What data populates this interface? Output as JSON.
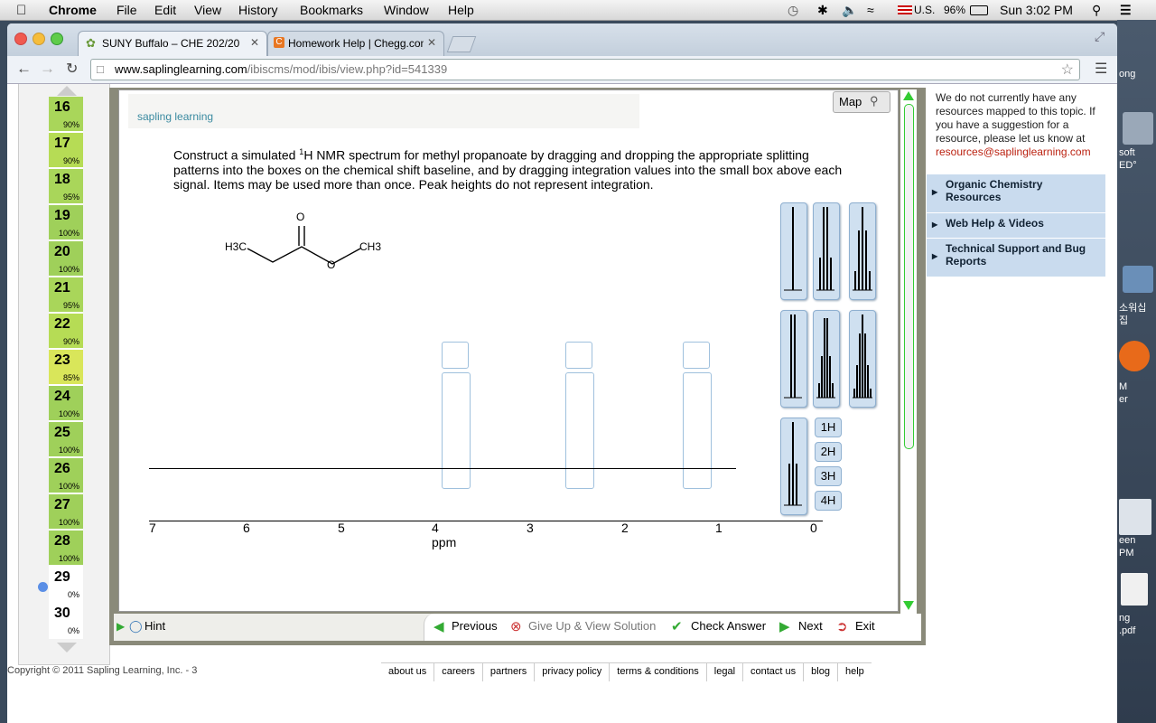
{
  "menubar": {
    "app": "Chrome",
    "items": [
      "File",
      "Edit",
      "View",
      "History",
      "Bookmarks",
      "Window",
      "Help"
    ],
    "input_source": "U.S.",
    "battery": "96%",
    "clock": "Sun 3:02 PM"
  },
  "tabs": [
    {
      "title": "SUNY Buffalo – CHE 202/20"
    },
    {
      "title": "Homework Help | Chegg.com"
    }
  ],
  "address": {
    "domain": "www.saplinglearning.com",
    "path": "/ibiscms/mod/ibis/view.php?id=541339"
  },
  "questions": [
    {
      "n": "16",
      "pct": "90%",
      "color": "#a9d65a"
    },
    {
      "n": "17",
      "pct": "90%",
      "color": "#b6dc55"
    },
    {
      "n": "18",
      "pct": "95%",
      "color": "#a9d65a"
    },
    {
      "n": "19",
      "pct": "100%",
      "color": "#9fd05a"
    },
    {
      "n": "20",
      "pct": "100%",
      "color": "#9fd05a"
    },
    {
      "n": "21",
      "pct": "95%",
      "color": "#a9d65a"
    },
    {
      "n": "22",
      "pct": "90%",
      "color": "#b6dc55"
    },
    {
      "n": "23",
      "pct": "85%",
      "color": "#d9e65a"
    },
    {
      "n": "24",
      "pct": "100%",
      "color": "#9fd05a"
    },
    {
      "n": "25",
      "pct": "100%",
      "color": "#9fd05a"
    },
    {
      "n": "26",
      "pct": "100%",
      "color": "#9fd05a"
    },
    {
      "n": "27",
      "pct": "100%",
      "color": "#9fd05a"
    },
    {
      "n": "28",
      "pct": "100%",
      "color": "#9fd05a"
    },
    {
      "n": "29",
      "pct": "0%",
      "color": "#ffffff"
    },
    {
      "n": "30",
      "pct": "0%",
      "color": "#ffffff"
    }
  ],
  "problem": {
    "logo": "sapling learning",
    "map_label": "Map",
    "instructions_a": "Construct a simulated ",
    "instructions_sup": "1",
    "instructions_b": "H NMR spectrum for methyl propanoate by dragging and dropping the appropriate splitting patterns into the boxes on the chemical shift baseline, and by dragging integration values into the small box above each signal. Items may be used more than once. Peak heights do not represent integration.",
    "molecule": {
      "left": "H3C",
      "o_top": "O",
      "o_ester": "O",
      "right": "CH3"
    },
    "axis_ticks": [
      "7",
      "6",
      "5",
      "4",
      "3",
      "2",
      "1",
      "0"
    ],
    "axis_label": "ppm",
    "integration_values": [
      "1H",
      "2H",
      "3H",
      "4H"
    ]
  },
  "hintbar": {
    "hint": "Hint",
    "previous": "Previous",
    "giveup": "Give Up & View Solution",
    "check": "Check Answer",
    "next": "Next",
    "exit": "Exit"
  },
  "resources": {
    "note": "We do not currently have any resources mapped to this topic. If you have a suggestion for a resource, please let us know at",
    "email": "resources@saplinglearning.com",
    "links": [
      "Organic Chemistry Resources",
      "Web Help & Videos",
      "Technical Support and Bug Reports"
    ]
  },
  "footer": {
    "copyright": "Copyright © 2011 Sapling Learning, Inc. - 3",
    "links": [
      "about us",
      "careers",
      "partners",
      "privacy policy",
      "terms & conditions",
      "legal",
      "contact us",
      "blog",
      "help"
    ]
  },
  "desktop": [
    "ong",
    "soft",
    "ED°",
    "소워십",
    "집",
    "M",
    "er",
    "een",
    "PM",
    "ng",
    ".pdf"
  ]
}
